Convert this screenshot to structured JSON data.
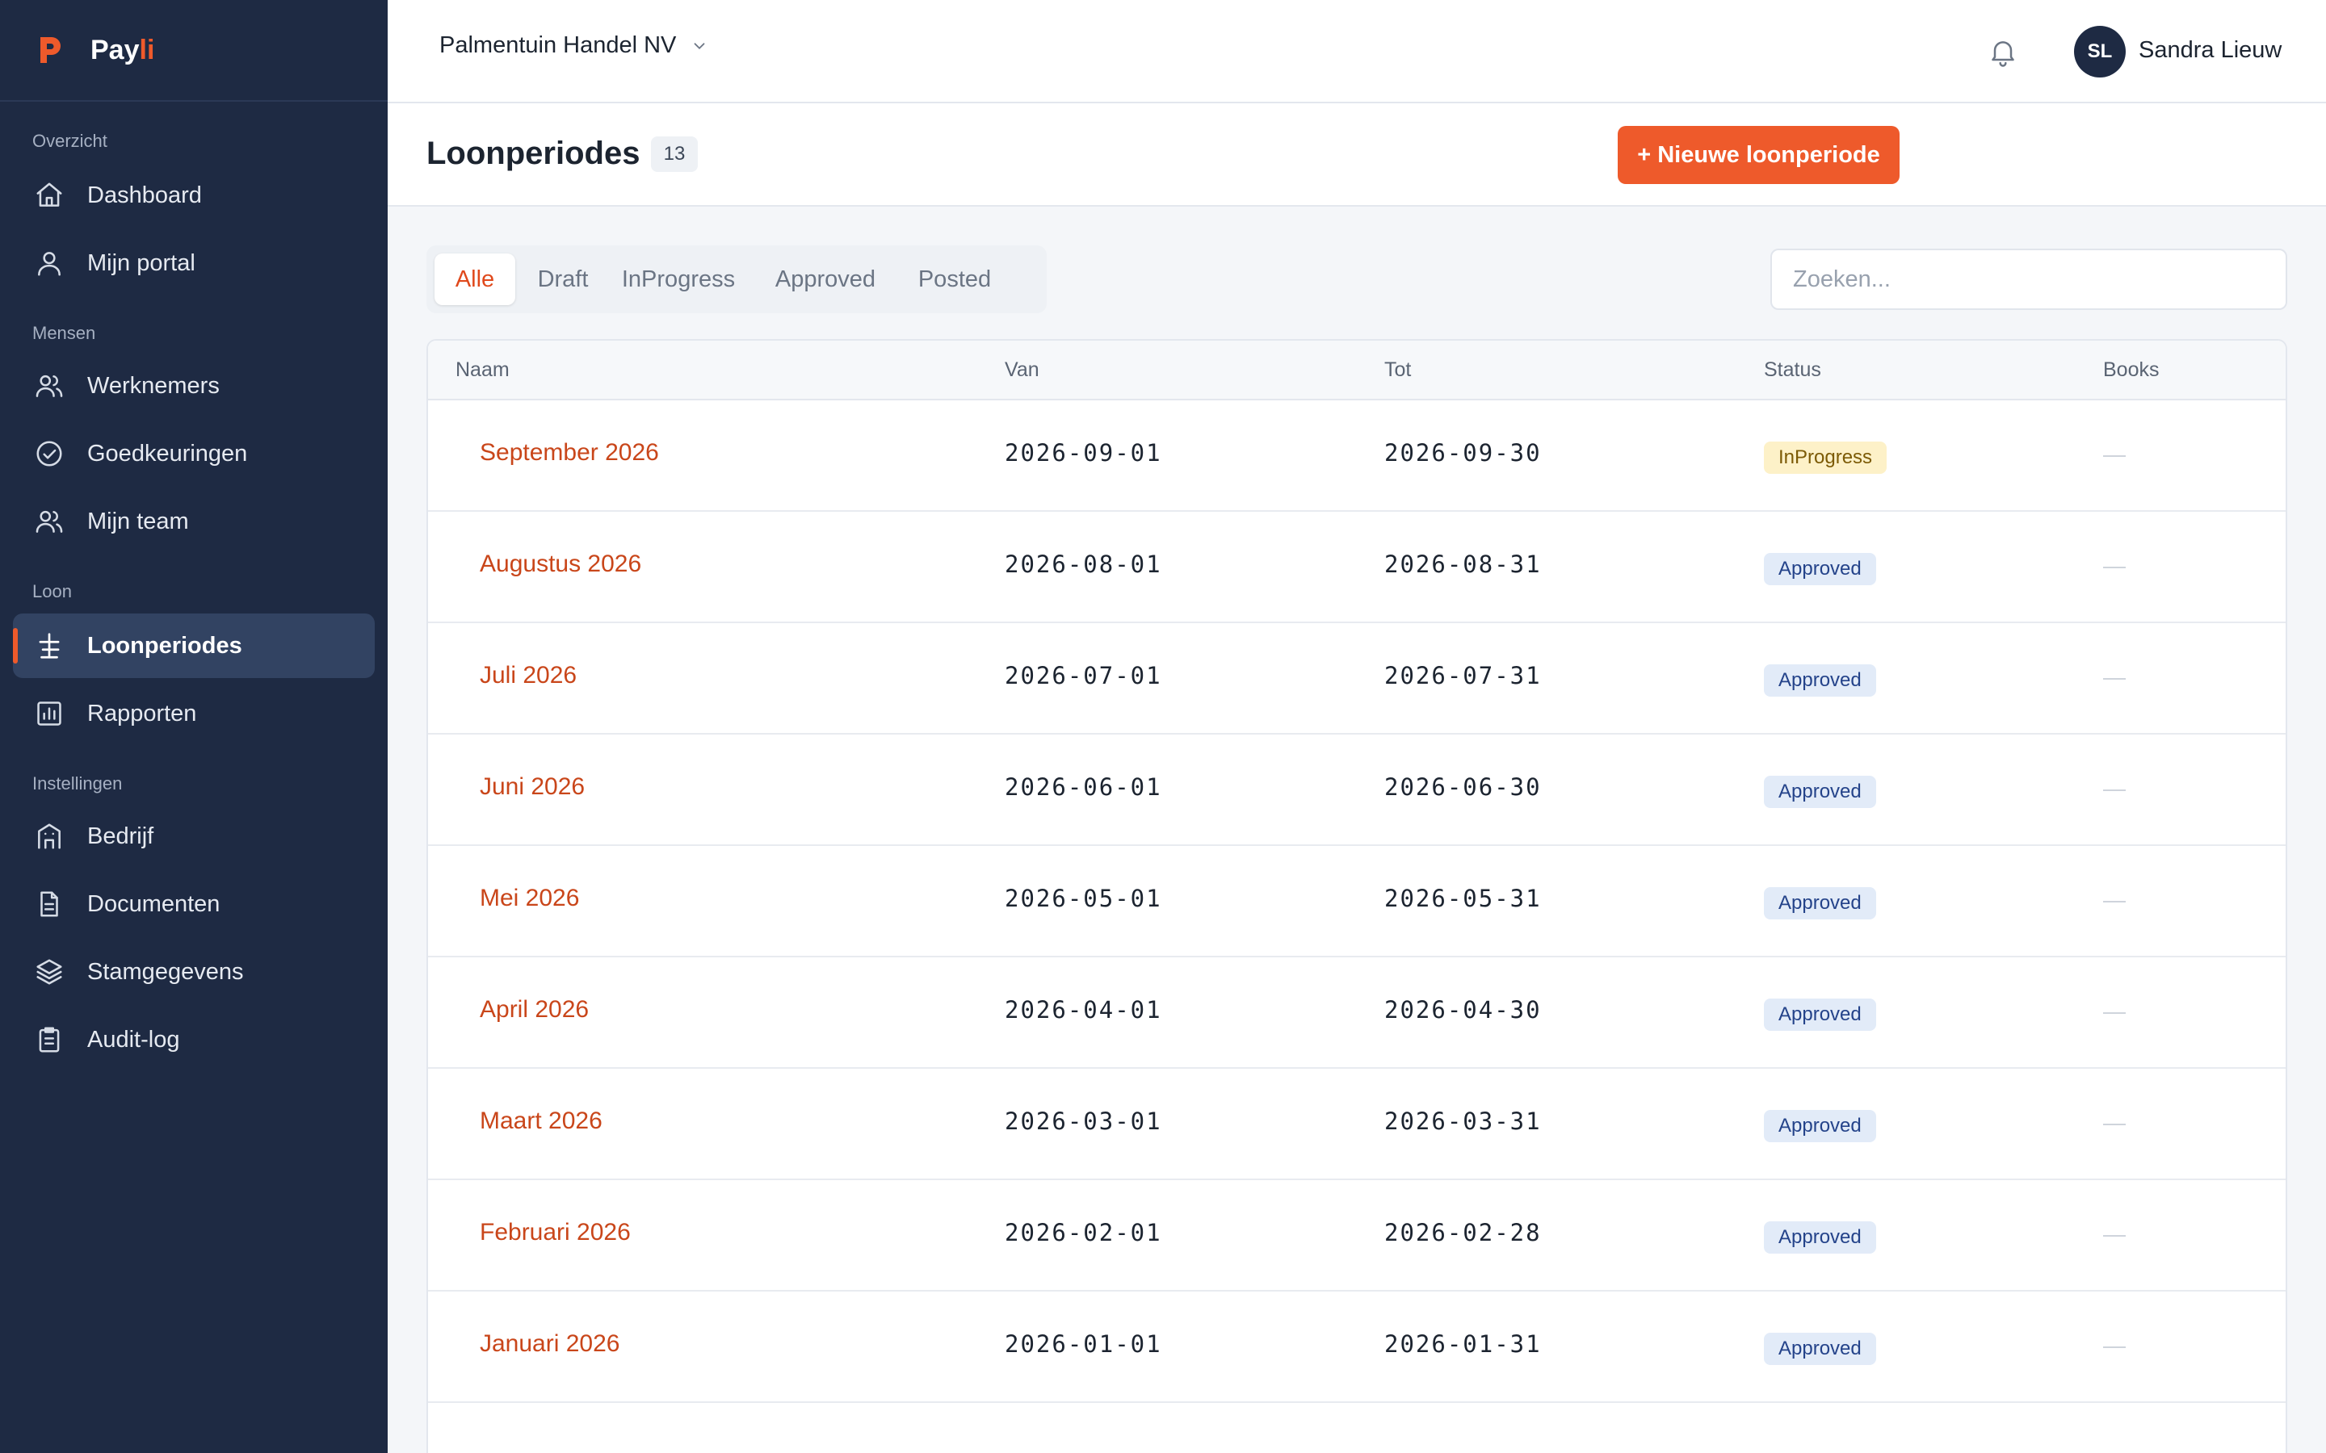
{
  "brand": {
    "name_prefix": "Pay",
    "name_accent": "li"
  },
  "sidebar": {
    "sections": [
      "Overzicht",
      "Mensen",
      "Loon",
      "Instellingen"
    ],
    "items": [
      {
        "label": "Dashboard",
        "icon": "home-icon"
      },
      {
        "label": "Mijn portal",
        "icon": "user-icon"
      },
      {
        "label": "Werknemers",
        "icon": "users-icon"
      },
      {
        "label": "Goedkeuringen",
        "icon": "check-circle-icon"
      },
      {
        "label": "Mijn team",
        "icon": "users-icon"
      },
      {
        "label": "Loonperiodes",
        "icon": "scale-icon",
        "active": true
      },
      {
        "label": "Rapporten",
        "icon": "bar-chart-icon"
      },
      {
        "label": "Bedrijf",
        "icon": "building-icon"
      },
      {
        "label": "Documenten",
        "icon": "document-icon"
      },
      {
        "label": "Stamgegevens",
        "icon": "layers-icon"
      },
      {
        "label": "Audit-log",
        "icon": "clipboard-icon"
      }
    ]
  },
  "topbar": {
    "company": "Palmentuin Handel NV",
    "user_initials": "SL",
    "user_name": "Sandra Lieuw"
  },
  "page": {
    "title": "Loonperiodes",
    "count": "13",
    "new_button": "+ Nieuwe loonperiode"
  },
  "filters": {
    "tabs": [
      "Alle",
      "Draft",
      "InProgress",
      "Approved",
      "Posted"
    ],
    "active": "Alle"
  },
  "search": {
    "placeholder": "Zoeken..."
  },
  "table": {
    "columns": [
      "Naam",
      "Van",
      "Tot",
      "Status",
      "Books"
    ],
    "rows": [
      {
        "name": "September 2026",
        "from": "2026-09-01",
        "to": "2026-09-30",
        "status": "InProgress",
        "books": "—"
      },
      {
        "name": "Augustus 2026",
        "from": "2026-08-01",
        "to": "2026-08-31",
        "status": "Approved",
        "books": "—"
      },
      {
        "name": "Juli 2026",
        "from": "2026-07-01",
        "to": "2026-07-31",
        "status": "Approved",
        "books": "—"
      },
      {
        "name": "Juni 2026",
        "from": "2026-06-01",
        "to": "2026-06-30",
        "status": "Approved",
        "books": "—"
      },
      {
        "name": "Mei 2026",
        "from": "2026-05-01",
        "to": "2026-05-31",
        "status": "Approved",
        "books": "—"
      },
      {
        "name": "April 2026",
        "from": "2026-04-01",
        "to": "2026-04-30",
        "status": "Approved",
        "books": "—"
      },
      {
        "name": "Maart 2026",
        "from": "2026-03-01",
        "to": "2026-03-31",
        "status": "Approved",
        "books": "—"
      },
      {
        "name": "Februari 2026",
        "from": "2026-02-01",
        "to": "2026-02-28",
        "status": "Approved",
        "books": "—"
      },
      {
        "name": "Januari 2026",
        "from": "2026-01-01",
        "to": "2026-01-31",
        "status": "Approved",
        "books": "—"
      }
    ]
  },
  "colors": {
    "sidebar_bg": "#1e2a43",
    "accent": "#ee5a2b",
    "approved_badge": "#e2ebf8",
    "inprogress_badge": "#fdf1c8"
  }
}
